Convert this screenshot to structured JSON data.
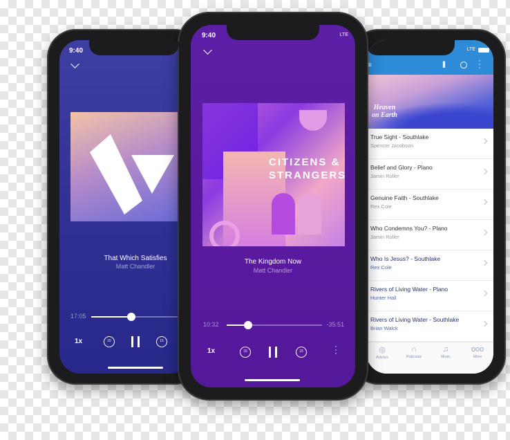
{
  "left_player": {
    "status_time": "9:40",
    "track_title": "That Which Satisfies",
    "artist": "Matt Chandler",
    "elapsed": "17:05",
    "progress": 0.4,
    "speed": "1x",
    "skip_back": "15",
    "skip_forward": "15"
  },
  "center_player": {
    "status_time": "9:40",
    "network": "LTE",
    "album_title_line1": "CITIZENS &",
    "album_title_line2": "STRANGERS",
    "track_title": "The Kingdom Now",
    "artist": "Matt Chandler",
    "elapsed": "10:32",
    "remaining": "-35:51",
    "progress": 0.227,
    "speed": "1x",
    "skip_back": "15",
    "skip_forward": "15"
  },
  "right_app": {
    "network": "LTE",
    "accent_color": "#2d8bd8",
    "banner_title_line1": "Heaven",
    "banner_title_line2": "on Earth",
    "items": [
      {
        "title": "True Sight - Southlake",
        "speaker": "Spencer Jacobson",
        "highlighted": false
      },
      {
        "title": "Belief and Glory - Plano",
        "speaker": "Jamin Roller",
        "highlighted": false
      },
      {
        "title": "Genuine Faith - Southlake",
        "speaker": "Rex Cole",
        "highlighted": false
      },
      {
        "title": "Who Condemns You? - Plano",
        "speaker": "Jamin Roller",
        "highlighted": false
      },
      {
        "title": "Who Is Jesus? - Southlake",
        "speaker": "Rex Cole",
        "highlighted": true
      },
      {
        "title": "Rivers of Living Water - Plano",
        "speaker": "Hunter Hall",
        "highlighted": true
      },
      {
        "title": "Rivers of Living Water - Southlake",
        "speaker": "Brian Walck",
        "highlighted": true
      }
    ],
    "tabs": [
      {
        "label": "Articles",
        "icon": "chat-icon"
      },
      {
        "label": "Podcasts",
        "icon": "headphones-icon"
      },
      {
        "label": "Music",
        "icon": "music-note-icon"
      },
      {
        "label": "More",
        "icon": "more-dots-icon"
      }
    ]
  }
}
